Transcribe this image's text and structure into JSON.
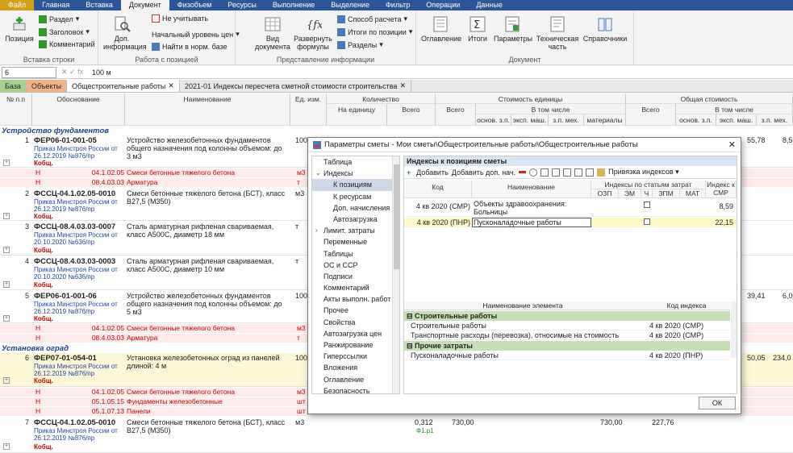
{
  "ribbon_tabs": [
    "Файл",
    "Главная",
    "Вставка",
    "Документ",
    "Физобъем",
    "Ресурсы",
    "Выполнение",
    "Выделение",
    "Фильтр",
    "Операции",
    "Данные"
  ],
  "ribbon": {
    "insert_row": {
      "position": "Позиция",
      "section": "Раздел",
      "heading": "Заголовок",
      "comment": "Комментарий",
      "group": "Вставка строки"
    },
    "position_work": {
      "doc_info": "Доп. информация",
      "not_count": "Не учитывать",
      "start_level": "Начальный уровень цен",
      "find_norm": "Найти в норм. базе",
      "group": "Работа с позицией"
    },
    "info_view": {
      "doc_view": "Вид документа",
      "expand_formulas": "Развернуть формулы",
      "calc_method": "Способ расчета",
      "totals_position": "Итоги по позиции",
      "sections": "Разделы",
      "group": "Представление информации"
    },
    "document": {
      "toc": "Оглавление",
      "totals": "Итоги",
      "params": "Параметры",
      "tech_part": "Техническая часть",
      "refs": "Справочники",
      "group": "Документ"
    }
  },
  "formula_bar": {
    "cell": "6",
    "value": "100 м"
  },
  "doc_tabs": {
    "base": "База",
    "objects": "Объекты",
    "general": "Общестроительные работы",
    "indices": "2021-01 Индексы пересчета сметной стоимости строительства"
  },
  "grid_header": {
    "num": "№ п.п",
    "basis": "Обоснование",
    "name": "Наименование",
    "unit": "Ед. изм.",
    "quantity": "Количество",
    "per_unit": "На единицу",
    "total": "Всего",
    "unit_cost": "Стоимость единицы",
    "incl": "В том числе",
    "total2": "Всего",
    "osn_zp": "основ. з.п.",
    "exp_mash": "эксп. маш.",
    "zp_meh": "з.п. мех.",
    "materials": "материалы",
    "general_cost": "Общая стоимость",
    "total3": "Всего",
    "incl2": "В том числе",
    "osn_zp2": "основ. з.п.",
    "exp_mash2": "эксп. маш.",
    "zp_meh2": "з.п. мех."
  },
  "sections": {
    "s1": "Устройство фундаментов",
    "s2": "Установка оград"
  },
  "rows": [
    {
      "num": "1",
      "code": "ФЕР06-01-001-05",
      "ref": "Приказ Минстроя России от 26.12.2019 №876/пр",
      "k": "Кобщ.",
      "name": "Устройство железобетонных фундаментов общего назначения под колонны объемом: до 3 м3",
      "unit": "100 м",
      "r1": "55,78",
      "r2": "8,5"
    },
    {
      "num": "2",
      "code": "ФССЦ-04.1.02.05-0010",
      "ref": "Приказ Минстроя России от 26.12.2019 №876/пр",
      "k": "Кобщ.",
      "name": "Смеси бетонные тяжелого бетона (БСТ), класс В27,5 (М350)",
      "unit": "м3"
    },
    {
      "num": "3",
      "code": "ФССЦ-08.4.03.03-0007",
      "ref": "Приказ Минстроя России от 20.10.2020 №636/пр",
      "k": "Кобщ.",
      "name": "Сталь арматурная рифленая свариваемая, класс А500С, диаметр 18 мм",
      "unit": "т"
    },
    {
      "num": "4",
      "code": "ФССЦ-08.4.03.03-0003",
      "ref": "Приказ Минстроя России от 20.10.2020 №636/пр",
      "k": "Кобщ.",
      "name": "Сталь арматурная рифленая свариваемая, класс А500С, диаметр 10 мм",
      "unit": "т"
    },
    {
      "num": "5",
      "code": "ФЕР06-01-001-06",
      "ref": "Приказ Минстроя России от 26.12.2019 №876/пр",
      "k": "Кобщ.",
      "name": "Устройство железобетонных фундаментов общего назначения под колонны объемом: до 5 м3",
      "unit": "100 м",
      "r1": "39,41",
      "r2": "6,0"
    },
    {
      "num": "6",
      "code": "ФЕР07-01-054-01",
      "ref": "Приказ Минстроя России от 26.12.2019 №876/пр",
      "k": "Кобщ.",
      "name": "Установка железобетонных оград из панелей длиной: 4 м",
      "unit": "100",
      "r1": "50,05",
      "r2": "234,0"
    },
    {
      "num": "7",
      "code": "ФССЦ-04.1.02.05-0010",
      "ref": "Приказ Минстроя России от 26.12.2019 №876/пр",
      "k": "Кобщ.",
      "name": "Смеси бетонные тяжелого бетона (БСТ), класс В27,5 (М350)",
      "unit": "м3",
      "qty": "0,312",
      "qty2": "Ф1.р1",
      "price": "730,00",
      "price2": "730,00",
      "total": "227,76"
    }
  ],
  "subrows": {
    "a1": {
      "h": "Н",
      "code": "04.1.02.05",
      "name": "Смеси бетонные тяжелого бетона",
      "unit": "м3"
    },
    "a2": {
      "h": "Н",
      "code": "08.4.03.03",
      "name": "Арматура",
      "unit": "т"
    },
    "b1": {
      "h": "Н",
      "code": "04.1.02.05",
      "name": "Смеси бетонные тяжелого бетона",
      "unit": "м3"
    },
    "b2": {
      "h": "Н",
      "code": "08.4.03.03",
      "name": "Арматура",
      "unit": "т"
    },
    "c1": {
      "h": "Н",
      "code": "04.1.02.05",
      "name": "Смеси бетонные тяжелого бетона",
      "unit": "м3"
    },
    "c2": {
      "h": "Н",
      "code": "05.1.05.15",
      "name": "Фундаменты железобетонные",
      "unit": "шт"
    },
    "c3": {
      "h": "Н",
      "code": "05.1.07.13",
      "name": "Панели",
      "unit": "шт"
    }
  },
  "dialog": {
    "title": "Параметры сметы - Мои сметы\\Общестроительные работы\\Общестроительные работы",
    "nav": [
      "Таблица",
      "Индексы",
      "К позициям",
      "К ресурсам",
      "Доп. начисления",
      "Автозагрузка",
      "Лимит. затраты",
      "Переменные",
      "Таблицы",
      "ОС и ССР",
      "Подписи",
      "Комментарий",
      "Акты выполн. работ",
      "Прочее",
      "Свойства",
      "Автозагрузка цен",
      "Ранжирование",
      "Гиперссылки",
      "Вложения",
      "Оглавление",
      "Безопасность"
    ],
    "panel_title": "Индексы к позициям сметы",
    "toolbar": {
      "add": "Добавить",
      "add_extra": "Добавить доп. нач.",
      "bind": "Привязка индексов"
    },
    "t1_head": {
      "code": "Код",
      "name": "Наименование",
      "by_cost": "Индексы по статьям затрат",
      "ozp": "ОЗП",
      "em": "ЭМ",
      "ch": "Ч",
      "zpm": "ЗПМ",
      "mat": "МАТ",
      "smr": "Индекс к СМР"
    },
    "t1_rows": [
      {
        "code": "4 кв 2020 (СМР)",
        "name": "Объекты здравоохранения: Больницы",
        "smr": "8,59"
      },
      {
        "code": "4 кв 2020 (ПНР)",
        "name": "Пусконаладочные работы",
        "smr": "22,15"
      }
    ],
    "t2_head": {
      "element": "Наименование элемента",
      "code": "Код индекса"
    },
    "groups": [
      {
        "name": "Строительные работы",
        "items": [
          {
            "name": "Строительные работы",
            "code": "4 кв 2020 (СМР)"
          },
          {
            "name": "Транспортные расходы (перевозка), относимые на стоимость",
            "code": "4 кв 2020 (СМР)"
          }
        ]
      },
      {
        "name": "Прочие затраты",
        "items": [
          {
            "name": "Пусконаладочные работы",
            "code": "4 кв 2020 (ПНР)"
          }
        ]
      }
    ],
    "ok": "ОК"
  }
}
